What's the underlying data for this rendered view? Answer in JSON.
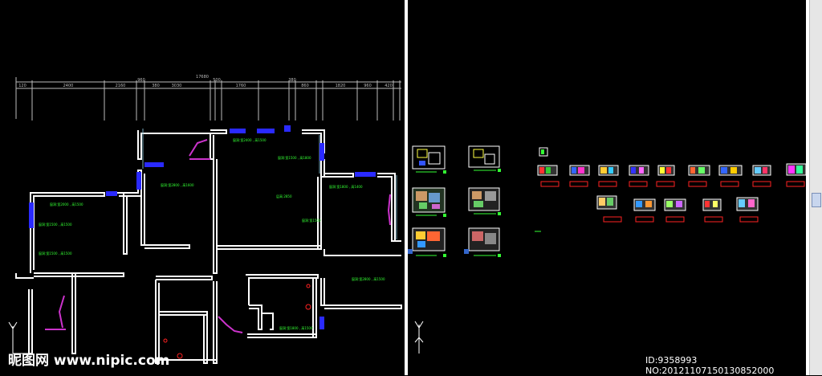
{
  "watermark": {
    "site": "昵图网 www.nipic.com",
    "id": "ID:9358993 NO:20121107150130852000"
  },
  "drawing": {
    "overall_dimension": "17680",
    "dim_segments": [
      "120",
      "2400",
      "2160",
      "960",
      "380",
      "3030",
      "500",
      "1760",
      "380",
      "860",
      "1820",
      "960",
      "420"
    ],
    "room_labels": [
      "窗洞:宽2000 , 高1500",
      "窗洞:宽1500 , 高1500",
      "窗洞:宽2800 , 高1600",
      "窗洞:宽2400 , 高1500",
      "窗洞:宽1500 , 高1800",
      "窗洞:宽1500 , 高1500",
      "窗洞:宽1500",
      "层高:2850",
      "窗洞:宽1800 , 高1400",
      "窗洞:宽2800 , 高1500",
      "窗洞:宽1800 , 高1500"
    ]
  },
  "colors": {
    "background": "#000000",
    "wall": "#ffffff",
    "window": "#2a2aff",
    "door": "#cc33cc",
    "label": "#33ff33",
    "marker": "#ff2222",
    "dimension": "#bbbbbb"
  },
  "icons": {
    "ucs": "ucs-axis-icon",
    "scroll": "scroll-thumb"
  }
}
